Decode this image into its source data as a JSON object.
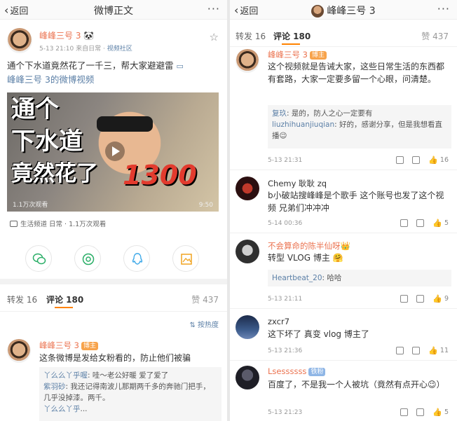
{
  "left": {
    "nav": {
      "back": "返回",
      "title": "微博正文",
      "more": "···"
    },
    "post": {
      "author": "峰峰三号 3",
      "author_emoji": "🐼",
      "time": "5-13 21:10",
      "source_prefix": "来自",
      "source": "日常",
      "source_sep": " · ",
      "channel": "视频社区",
      "text": "通个下水道竟然花了一千三，帮大家避避雷",
      "video_link": "峰峰三号 3的微博视频",
      "video": {
        "caption_line1": "通个",
        "caption_line2": "下水道",
        "caption_line3": "竟然花了",
        "caption_number": "1300",
        "views": "1.1万次观看",
        "duration": "9:50"
      },
      "video_source": "生活频道 日常 · 1.1万次观看"
    },
    "share_icons": [
      "wechat-icon",
      "moments-icon",
      "qq-icon",
      "save-image-icon"
    ],
    "tabs": {
      "repost": "转发 16",
      "comment": "评论 180",
      "like": "赞 437"
    },
    "sort_label": "按热度",
    "comment": {
      "name": "峰峰三号 3",
      "badge": "博主",
      "text": "这条微博是发给女粉看的，防止他们被骗",
      "replies": [
        {
          "who": "丫么么丫乎喔",
          "text": ": 哇～老公好暖 爱了爱了"
        },
        {
          "who": "紫羽砂",
          "text": ": 我还记得南波儿那期两千多的奔驰门把手，几乎没掉漆。两千。"
        },
        {
          "who": "丫么么丫乎",
          "text": "..."
        }
      ]
    }
  },
  "right": {
    "nav": {
      "back": "返回",
      "title": "峰峰三号 3",
      "more": "···"
    },
    "tabs": {
      "repost": "转发 16",
      "comment": "评论 180",
      "like": "赞 437"
    },
    "comments": [
      {
        "name": "峰峰三号 3",
        "badge": "博主",
        "text": "这个视频就是告诫大家，这些日常生活的东西都有套路，大家一定要多留一个心眼，问清楚。",
        "replies": [
          {
            "who": "复玖",
            "text": ": 是的，防人之心一定要有"
          },
          {
            "who": "liuzhihuanjiuqian",
            "text": ": 好的，感谢分享，但是我想看直播😉"
          }
        ],
        "time": "5-13 21:31",
        "likes": "16"
      },
      {
        "name": "Chemy 耿耿 zq",
        "text": "b小破站搜峰峰是个歌手 这个账号也发了这个视频 兄弟们冲冲冲",
        "time": "5-14 00:36",
        "likes": "5"
      },
      {
        "name": "不会算命的陈半仙呀",
        "badge_emoji": "👑",
        "text": "转型 VLOG 博主 🤗",
        "replies": [
          {
            "who": "Heartbeat_20",
            "text": ": 哈哈"
          }
        ],
        "time": "5-13 21:11",
        "likes": "9"
      },
      {
        "name": "zxcr7",
        "text": "这下坏了 真变 vlog 博主了",
        "time": "5-13 21:36",
        "likes": "11"
      },
      {
        "name": "Lsessssss",
        "badge": "铁粉",
        "text": "百度了，不是我一个人被坑（竟然有点开心😉）",
        "time": "5-13 21:23",
        "likes": "5"
      }
    ]
  },
  "colors": {
    "username": "#eb7350",
    "link": "#5b7fa6",
    "accent": "#ff8200"
  }
}
